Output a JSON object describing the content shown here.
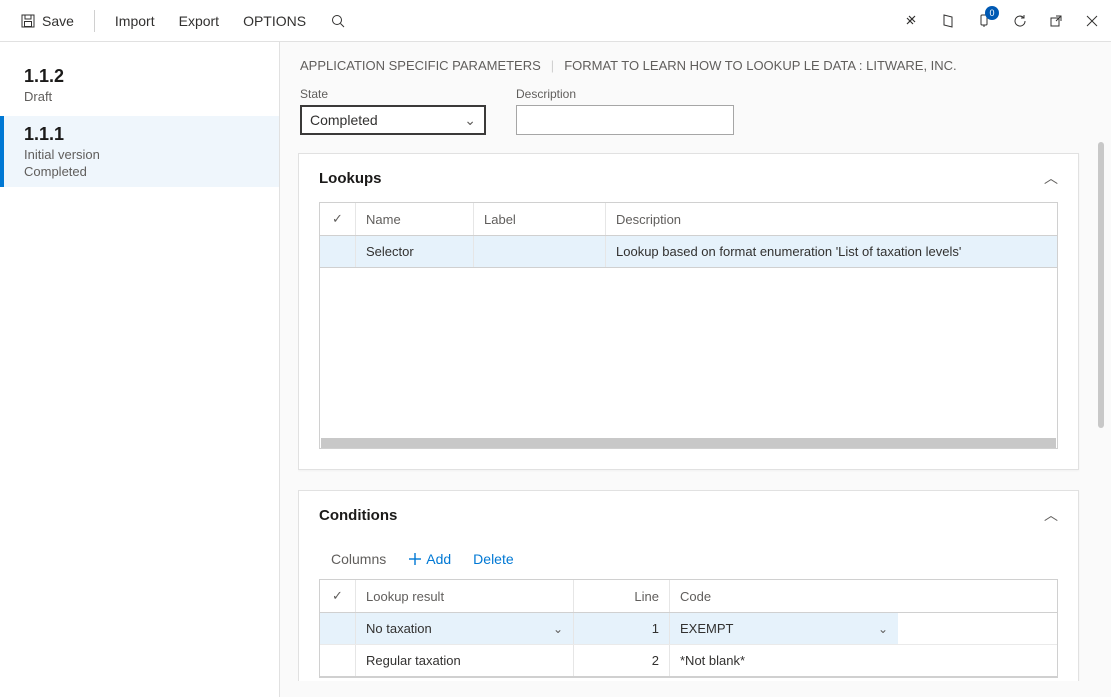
{
  "toolbar": {
    "save": "Save",
    "import": "Import",
    "export": "Export",
    "options": "OPTIONS",
    "notification_count": "0"
  },
  "sidebar": {
    "items": [
      {
        "title": "1.1.2",
        "line1": "Draft",
        "line2": ""
      },
      {
        "title": "1.1.1",
        "line1": "Initial version",
        "line2": "Completed"
      }
    ]
  },
  "breadcrumb": {
    "part1": "APPLICATION SPECIFIC PARAMETERS",
    "part2": "FORMAT TO LEARN HOW TO LOOKUP LE DATA : LITWARE, INC."
  },
  "fields": {
    "state_label": "State",
    "state_value": "Completed",
    "description_label": "Description",
    "description_value": ""
  },
  "lookups": {
    "title": "Lookups",
    "columns": {
      "name": "Name",
      "label": "Label",
      "description": "Description"
    },
    "rows": [
      {
        "name": "Selector",
        "label": "",
        "description": "Lookup based on format enumeration 'List of taxation levels'"
      }
    ]
  },
  "conditions": {
    "title": "Conditions",
    "toolbar": {
      "columns": "Columns",
      "add": "Add",
      "delete": "Delete"
    },
    "columns": {
      "result": "Lookup result",
      "line": "Line",
      "code": "Code"
    },
    "rows": [
      {
        "result": "No taxation",
        "line": "1",
        "code": "EXEMPT"
      },
      {
        "result": "Regular taxation",
        "line": "2",
        "code": "*Not blank*"
      }
    ]
  }
}
